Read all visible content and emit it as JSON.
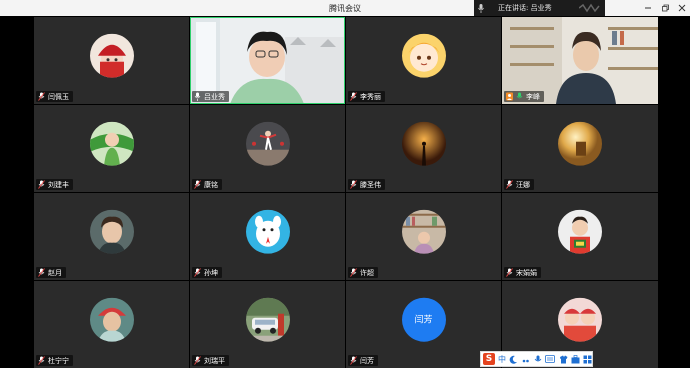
{
  "window": {
    "title": "腾讯会议"
  },
  "speaking": {
    "label": "正在讲话: 吕业秀"
  },
  "participants": [
    {
      "name": "闫佩玉",
      "avatar": "cartoon-red-hat-girl"
    },
    {
      "name": "吕业秀",
      "avatar": "video-woman-glasses"
    },
    {
      "name": "李秀丽",
      "avatar": "anime-girl"
    },
    {
      "name": "李峰",
      "avatar": "video-woman-room"
    },
    {
      "name": "刘建丰",
      "avatar": "child-green-leaf"
    },
    {
      "name": "康铭",
      "avatar": "dancer-stage"
    },
    {
      "name": "滕圣伟",
      "avatar": "dark-sunset-figure"
    },
    {
      "name": "汪娜",
      "avatar": "warm-light-scene"
    },
    {
      "name": "赵月",
      "avatar": "boy-portrait"
    },
    {
      "name": "孙坤",
      "avatar": "cartoon-white-dog"
    },
    {
      "name": "许超",
      "avatar": "bookshelf-photo"
    },
    {
      "name": "宋娟娟",
      "avatar": "child-red-shirt"
    },
    {
      "name": "杜宁宁",
      "avatar": "cap-portrait"
    },
    {
      "name": "刘瑞平",
      "avatar": "car-street"
    },
    {
      "name": "闫芳",
      "avatar_text": "闫芳",
      "avatar_color": "#1e7cf2"
    },
    {
      "name": "",
      "avatar": "red-cartoon-kids"
    }
  ],
  "ime": {
    "lang": "中",
    "icons": [
      "sogou-icon",
      "chinese-mode",
      "moon-icon",
      "punctuation-icon",
      "voice-icon",
      "keyboard-icon",
      "skin-icon",
      "toolbox-icon",
      "grid-icon"
    ]
  },
  "colors": {
    "active": "#2fd06c",
    "accent": "#e8731a",
    "tile": "#2b2b2b"
  }
}
